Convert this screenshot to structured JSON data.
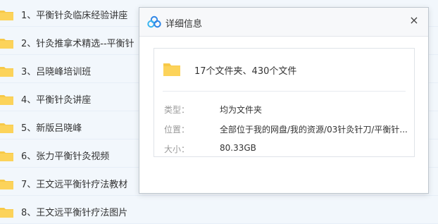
{
  "file_list": {
    "items": [
      {
        "label": "1、平衡针灸临床经验讲座"
      },
      {
        "label": "2、针灸推拿术精选--平衡针"
      },
      {
        "label": "3、吕晓峰培训班"
      },
      {
        "label": "4、平衡针灸讲座"
      },
      {
        "label": "5、新版吕晓峰"
      },
      {
        "label": "6、张力平衡针灸视频"
      },
      {
        "label": "7、王文远平衡针疗法教材"
      },
      {
        "label": "8、王文远平衡针疗法图片"
      }
    ]
  },
  "dialog": {
    "title": "详细信息",
    "close_icon": "×",
    "summary": "17个文件夹、430个文件",
    "type_label": "类型：",
    "type_value": "均为文件夹",
    "location_label": "位置：",
    "location_value": "全部位于我的网盘/我的资源/03针灸针刀/平衡针...",
    "size_label": "大小：",
    "size_value": "80.33GB"
  },
  "colors": {
    "folder": "#f7c948",
    "background": "#f2f7fc",
    "logo_blue": "#2f86e6"
  }
}
